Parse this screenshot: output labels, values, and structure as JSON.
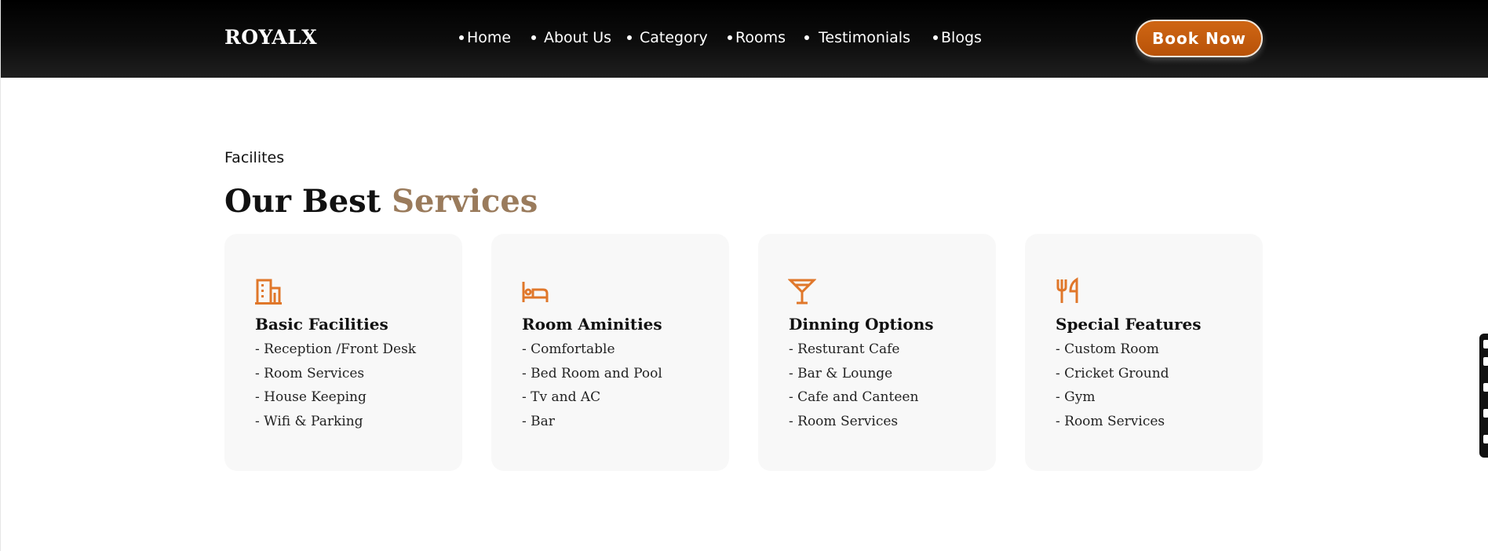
{
  "header": {
    "brand": "ROYALX",
    "nav": [
      {
        "label": "Home"
      },
      {
        "label": "About Us"
      },
      {
        "label": "Category"
      },
      {
        "label": "Rooms"
      },
      {
        "label": "Testimonials"
      },
      {
        "label": "Blogs"
      }
    ],
    "cta_label": "Book Now"
  },
  "section": {
    "eyebrow": "Facilites",
    "title_part1": "Our Best",
    "title_part2": "Services"
  },
  "cards": [
    {
      "icon": "building-icon",
      "title": "Basic Facilities",
      "items": [
        "- Reception /Front Desk",
        "- Room Services",
        "- House Keeping",
        "- Wifi & Parking"
      ]
    },
    {
      "icon": "bed-icon",
      "title": "Room Aminities",
      "items": [
        "- Comfortable",
        "- Bed Room and Pool",
        "- Tv and AC",
        "- Bar"
      ]
    },
    {
      "icon": "cocktail-icon",
      "title": "Dinning Options",
      "items": [
        "- Resturant Cafe",
        "- Bar & Lounge",
        "- Cafe and Canteen",
        "- Room Services"
      ]
    },
    {
      "icon": "utensils-icon",
      "title": "Special Features",
      "items": [
        "- Custom Room",
        "- Cricket Ground",
        "- Gym",
        "- Room Services"
      ]
    }
  ],
  "colors": {
    "accent_orange": "#e0772a",
    "title_accent": "#9a7b5c",
    "card_bg": "#f8f8f8",
    "header_bg": "#000000",
    "cta_bg": "#c65c0e"
  }
}
